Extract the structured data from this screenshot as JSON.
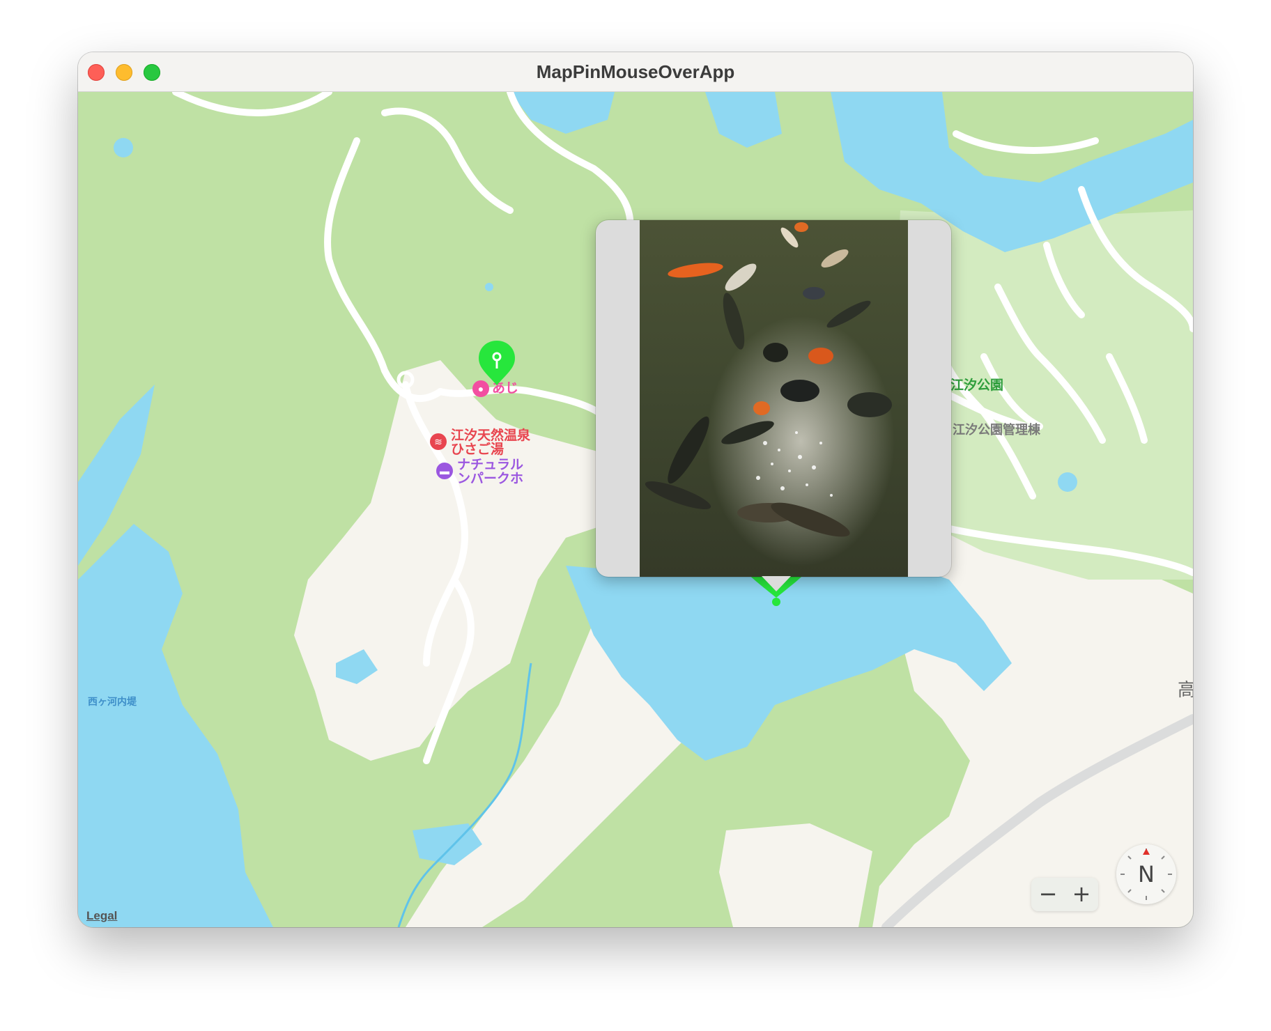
{
  "window": {
    "title": "MapPinMouseOverApp"
  },
  "map": {
    "labels": {
      "zoo": "あじ",
      "onsen_line1": "江汐天然温泉",
      "onsen_line2": "ひさご湯",
      "hotel_line1": "ナチュラル",
      "hotel_line2": "ンパークホ",
      "park": "江汐公園",
      "park_office": "江汐公園管理棟",
      "levee": "西ヶ河内堤",
      "edge_char": "高"
    },
    "legal": "Legal"
  },
  "controls": {
    "zoom_out": "−",
    "zoom_in": "+",
    "compass_label": "N"
  },
  "colors": {
    "land": "#bfe1a4",
    "water": "#8fd8f2",
    "urban": "#f6f4ee",
    "road": "#ffffff",
    "pin": "#27e63c",
    "zoo": "#f24fa1",
    "onsen": "#e8454f",
    "hotel": "#9b57e0",
    "park_label": "#2f9e3c"
  },
  "icons": [
    "pin-icon",
    "elephant-icon",
    "hot-spring-icon",
    "bed-icon",
    "compass-needle-icon"
  ]
}
